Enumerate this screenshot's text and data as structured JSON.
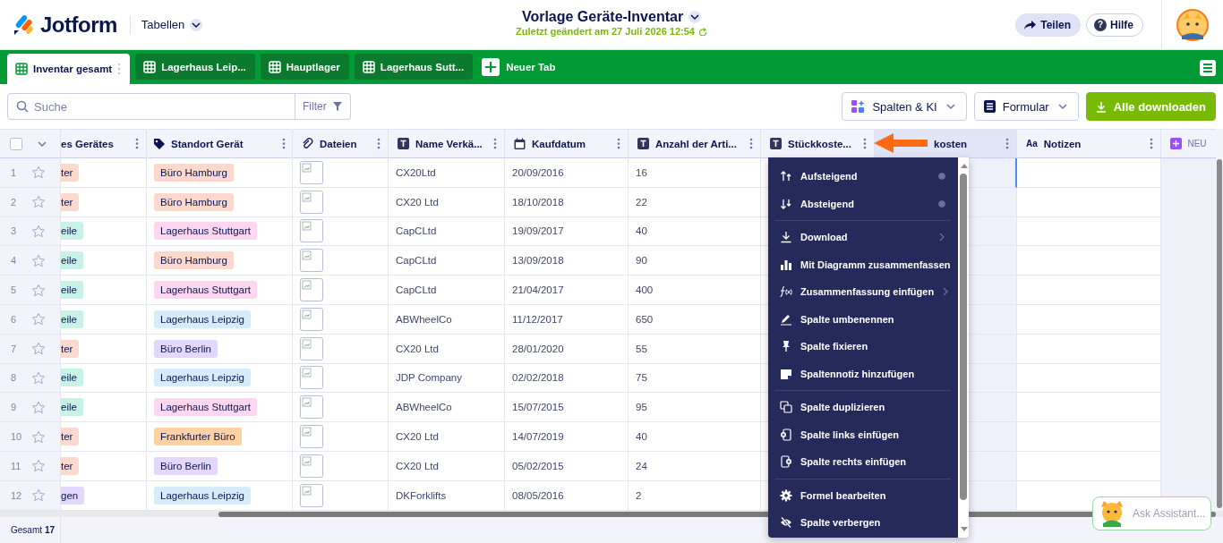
{
  "app": {
    "logo": "Jotform",
    "section": "Tabellen"
  },
  "document": {
    "title": "Vorlage Geräte-Inventar",
    "saved": "Zuletzt geändert am 27 Juli 2026 12:54"
  },
  "header_buttons": [
    {
      "label": "Teilen",
      "kind": "share"
    },
    {
      "label": "Hilfe",
      "kind": "help",
      "icon": "?"
    }
  ],
  "tabs": [
    {
      "label": "Inventar gesamt",
      "selected": true
    },
    {
      "label": "Lagerhaus Leip...",
      "selected": false
    },
    {
      "label": "Hauptlager",
      "selected": false
    },
    {
      "label": "Lagerhaus Sutt...",
      "selected": false
    }
  ],
  "new_tab": "Neuer Tab",
  "toolbar": {
    "search_placeholder": "Suche",
    "filter": "Filter",
    "buttons": [
      {
        "label": "Spalten & KI",
        "kind": "columns"
      },
      {
        "label": "Formular",
        "kind": "form"
      },
      {
        "label": "Alle downloaden",
        "kind": "download"
      }
    ]
  },
  "table": {
    "columns": [
      {
        "label": "es Gerätes",
        "kind": "cut",
        "selected": false
      },
      {
        "label": "Standort Gerät",
        "kind": "tag",
        "selected": false
      },
      {
        "label": "Dateien",
        "kind": "file",
        "selected": false
      },
      {
        "label": "Name Verkä...",
        "kind": "text",
        "selected": false
      },
      {
        "label": "Kaufdatum",
        "kind": "date",
        "selected": false
      },
      {
        "label": "Anzahl der Arti...",
        "kind": "text",
        "selected": false
      },
      {
        "label": "Stückkoste...",
        "kind": "text",
        "selected": false
      },
      {
        "label": "kosten",
        "kind": "covered",
        "selected": true
      },
      {
        "label": "Notizen",
        "kind": "longtext",
        "icon_label": "Aa",
        "selected": false
      }
    ],
    "new_column": "NEU",
    "select_all_checked": false,
    "rows": [
      {
        "number": "1",
        "starred": false,
        "type": {
          "text": "ter",
          "color": "#fdd8cc"
        },
        "location": {
          "text": "Büro Hamburg",
          "color": "#fdd8cc"
        },
        "vendor": "CX20Ltd",
        "date": "20/09/2016",
        "quantity": "16"
      },
      {
        "number": "2",
        "starred": false,
        "type": {
          "text": "ter",
          "color": "#fdd8cc"
        },
        "location": {
          "text": "Büro Hamburg",
          "color": "#fdd8cc"
        },
        "vendor": "CX20 Ltd",
        "date": "18/10/2018",
        "quantity": "22"
      },
      {
        "number": "3",
        "starred": false,
        "type": {
          "text": "eile",
          "color": "#c8f1e7"
        },
        "location": {
          "text": "Lagerhaus Stuttgart",
          "color": "#fcd7ef"
        },
        "vendor": "CapCLtd",
        "date": "19/09/2017",
        "quantity": "40"
      },
      {
        "number": "4",
        "starred": false,
        "type": {
          "text": "eile",
          "color": "#c8f1e7"
        },
        "location": {
          "text": "Büro Hamburg",
          "color": "#fdd8cc"
        },
        "vendor": "CapCLtd",
        "date": "13/09/2018",
        "quantity": "90"
      },
      {
        "number": "5",
        "starred": false,
        "type": {
          "text": "eile",
          "color": "#c8f1e7"
        },
        "location": {
          "text": "Lagerhaus Stuttgart",
          "color": "#fcd7ef"
        },
        "vendor": "CapCLtd",
        "date": "21/04/2017",
        "quantity": "400"
      },
      {
        "number": "6",
        "starred": false,
        "type": {
          "text": "eile",
          "color": "#c8f1e7"
        },
        "location": {
          "text": "Lagerhaus Leipzig",
          "color": "#d5edfa"
        },
        "vendor": "ABWheelCo",
        "date": "11/12/2017",
        "quantity": "650"
      },
      {
        "number": "7",
        "starred": false,
        "type": {
          "text": "ter",
          "color": "#fdd8cc"
        },
        "location": {
          "text": "Büro Berlin",
          "color": "#e3d7fb"
        },
        "vendor": "CX20 Ltd",
        "date": "28/01/2020",
        "quantity": "55"
      },
      {
        "number": "8",
        "starred": false,
        "type": {
          "text": "eile",
          "color": "#c8f1e7"
        },
        "location": {
          "text": "Lagerhaus Leipzig",
          "color": "#d5edfa"
        },
        "vendor": "JDP Company",
        "date": "02/02/2018",
        "quantity": "75"
      },
      {
        "number": "9",
        "starred": false,
        "type": {
          "text": "eile",
          "color": "#c8f1e7"
        },
        "location": {
          "text": "Lagerhaus Stuttgart",
          "color": "#fcd7ef"
        },
        "vendor": "ABWheelCo",
        "date": "15/07/2015",
        "quantity": "95"
      },
      {
        "number": "10",
        "starred": false,
        "type": {
          "text": "ter",
          "color": "#fdd8cc"
        },
        "location": {
          "text": "Frankfurter Büro",
          "color": "#ffd1a3"
        },
        "vendor": "CX20 Ltd",
        "date": "14/07/2019",
        "quantity": "40"
      },
      {
        "number": "11",
        "starred": false,
        "type": {
          "text": "ter",
          "color": "#fdd8cc"
        },
        "location": {
          "text": "Büro Berlin",
          "color": "#e3d7fb"
        },
        "vendor": "CX20 Ltd",
        "date": "05/02/2015",
        "quantity": "24"
      },
      {
        "number": "12",
        "starred": false,
        "type": {
          "text": "gen",
          "color": "#e3d7fb"
        },
        "location": {
          "text": "Lagerhaus Leipzig",
          "color": "#d5edfa"
        },
        "vendor": "DKForklifts",
        "date": "08/05/2016",
        "quantity": "2"
      }
    ]
  },
  "status_bar": {
    "label": "Gesamt",
    "count": "17"
  },
  "column_menu": {
    "groups": [
      [
        {
          "label": "Aufsteigend",
          "kind": "sort-asc",
          "selected": false
        },
        {
          "label": "Absteigend",
          "kind": "sort-desc",
          "selected": false
        }
      ],
      [
        {
          "label": "Download",
          "kind": "download"
        },
        {
          "label": "Mit Diagramm zusammenfassen",
          "kind": "chart"
        },
        {
          "label": "Zusammenfassung einfügen",
          "kind": "formula"
        },
        {
          "label": "Spalte umbenennen",
          "kind": "rename"
        },
        {
          "label": "Spalte fixieren",
          "kind": "pin"
        },
        {
          "label": "Spaltennotiz hinzufügen",
          "kind": "note"
        }
      ],
      [
        {
          "label": "Spalte duplizieren",
          "kind": "duplicate"
        },
        {
          "label": "Spalte links einfügen",
          "kind": "insert-left"
        },
        {
          "label": "Spalte rechts einfügen",
          "kind": "insert-right"
        }
      ],
      [
        {
          "label": "Formel bearbeiten",
          "kind": "gear"
        },
        {
          "label": "Spalte verbergen",
          "kind": "hide"
        }
      ]
    ]
  },
  "assistant": {
    "placeholder": "Ask Assistant..."
  }
}
